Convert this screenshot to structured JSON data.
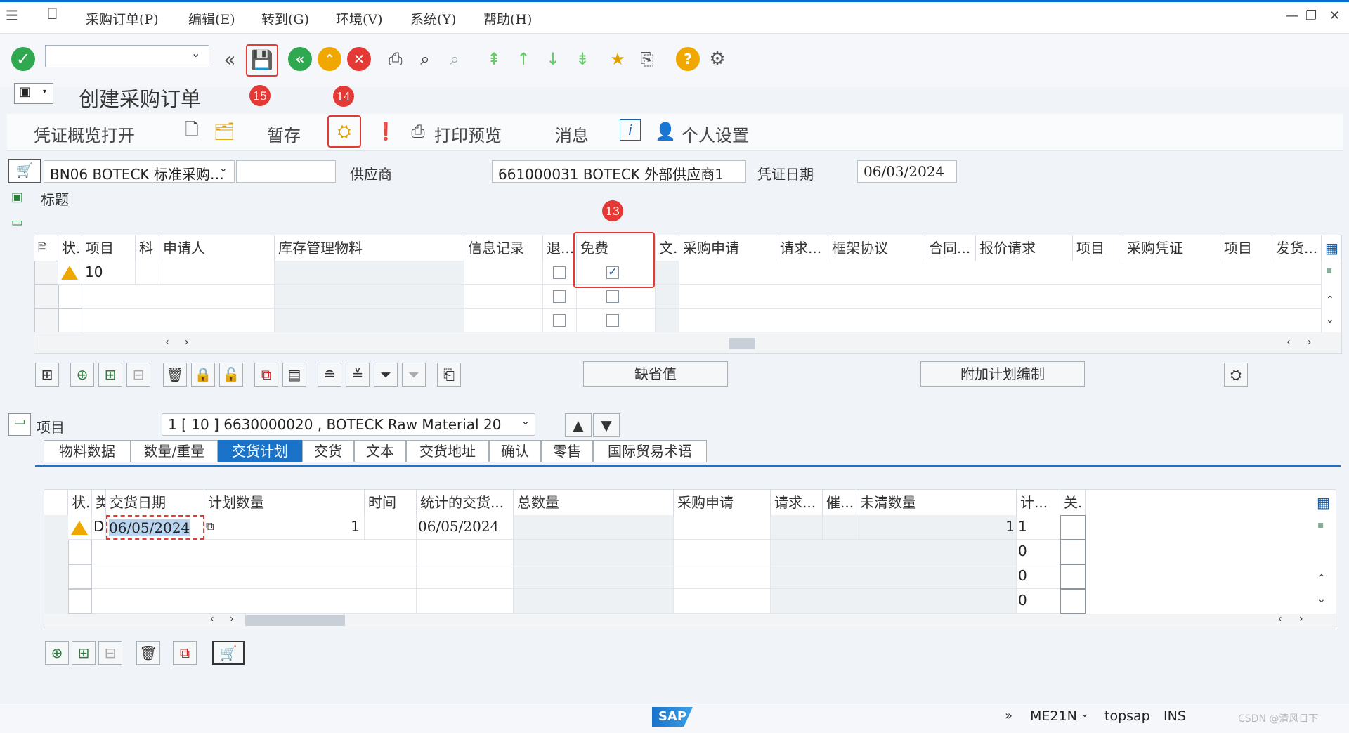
{
  "menu": {
    "items": [
      "采购订单(P)",
      "编辑(E)",
      "转到(G)",
      "环境(V)",
      "系统(Y)",
      "帮助(H)"
    ],
    "window_controls": [
      "—",
      "❐",
      "✕"
    ]
  },
  "toolbar": {
    "command_field": {
      "value": "",
      "placeholder": ""
    },
    "badges": [
      "15",
      "14",
      "13"
    ]
  },
  "title": "创建采购订单",
  "app_toolbar": {
    "overview": "凭证概览打开",
    "hold": "暂存",
    "print_preview": "打印预览",
    "messages": "消息",
    "personal": "个人设置"
  },
  "header": {
    "doc_type": "BN06 BOTECK 标准采购…",
    "doc_type_extra": "",
    "vendor_label": "供应商",
    "vendor": "661000031 BOTECK 外部供应商1",
    "doc_date_label": "凭证日期",
    "doc_date": "06/03/2024",
    "section": "标题"
  },
  "items_table": {
    "columns": [
      "状.",
      "项目",
      "科",
      "申请人",
      "库存管理物料",
      "信息记录",
      "退...",
      "免费",
      "文.",
      "采购申请",
      "请求...",
      "框架协议",
      "合同...",
      "报价请求",
      "项目",
      "采购凭证",
      "项目",
      "发货..."
    ],
    "rows": [
      {
        "status": "warning",
        "item": "10",
        "return": false,
        "free": true
      },
      {
        "status": "",
        "item": "",
        "return": false,
        "free": false
      },
      {
        "status": "",
        "item": "",
        "return": false,
        "free": false
      }
    ],
    "buttons": {
      "default_values": "缺省值",
      "addl_planning": "附加计划编制"
    }
  },
  "item_detail": {
    "label": "项目",
    "selector": "1 [ 10 ] 6630000020 , BOTECK Raw Material 20",
    "tabs": [
      "物料数据",
      "数量/重量",
      "交货计划",
      "交货",
      "文本",
      "交货地址",
      "确认",
      "零售",
      "国际贸易术语"
    ],
    "active_tab": "交货计划"
  },
  "schedule_table": {
    "columns": [
      "状.",
      "类",
      "交货日期",
      "计划数量",
      "时间",
      "统计的交货...",
      "总数量",
      "采购申请",
      "请求...",
      "催...",
      "未清数量",
      "计...",
      "关."
    ],
    "rows": [
      {
        "status": "warning",
        "cat": "D",
        "date": "06/05/2024",
        "qty": "1",
        "stat_date": "06/05/2024",
        "open_qty": "1",
        "plan": "1"
      },
      {
        "status": "",
        "cat": "",
        "date": "",
        "qty": "",
        "stat_date": "",
        "open_qty": "",
        "plan": "0"
      },
      {
        "status": "",
        "cat": "",
        "date": "",
        "qty": "",
        "stat_date": "",
        "open_qty": "",
        "plan": "0"
      },
      {
        "status": "",
        "cat": "",
        "date": "",
        "qty": "",
        "stat_date": "",
        "open_qty": "",
        "plan": "0"
      }
    ]
  },
  "status_bar": {
    "brand": "SAP",
    "transaction": "ME21N",
    "server": "topsap",
    "mode": "INS",
    "watermark": "CSDN @清风日下"
  },
  "colors": {
    "accent": "#1a73c9",
    "highlight": "#e53935",
    "ok": "#2fa84f",
    "warn": "#f0a800"
  }
}
